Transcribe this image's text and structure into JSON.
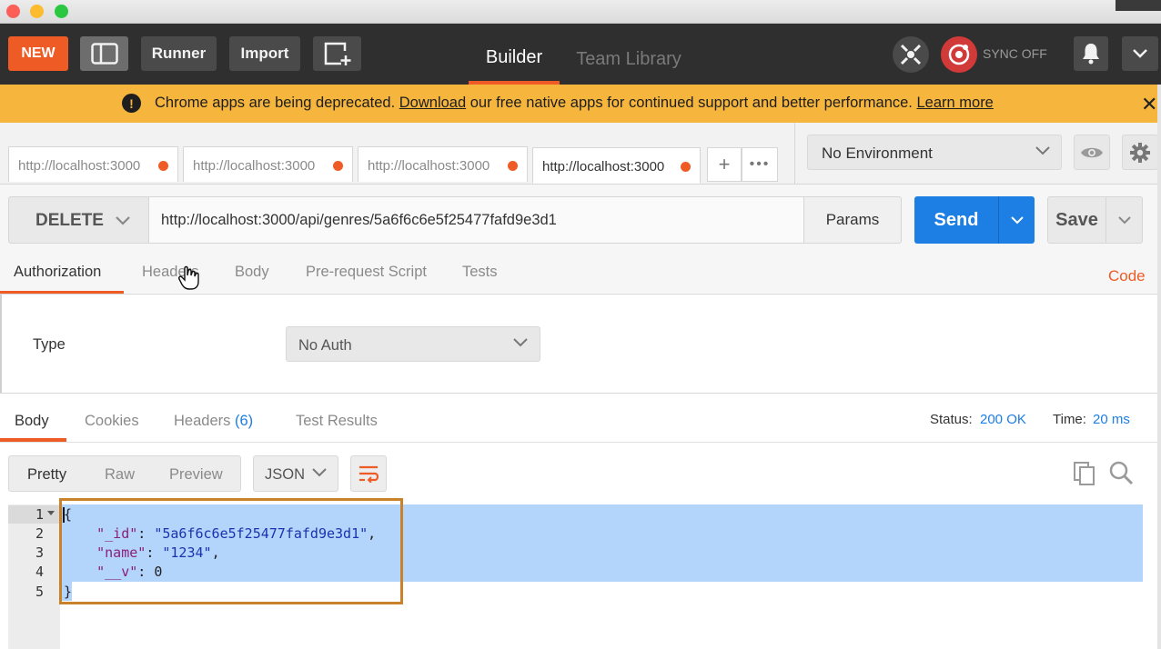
{
  "toolbar": {
    "new_label": "NEW",
    "runner_label": "Runner",
    "import_label": "Import",
    "tabs": [
      {
        "label": "Builder",
        "active": true
      },
      {
        "label": "Team Library",
        "active": false
      }
    ],
    "sync_label": "SYNC OFF",
    "accent_color": "#ef5b25"
  },
  "banner": {
    "text_before": "Chrome apps are being deprecated.",
    "download_link": "Download",
    "text_middle": "our free native apps for continued support and better performance.",
    "learn_more_link": "Learn more",
    "close_label": "✕",
    "color": "#f6b53d"
  },
  "request_tabs": [
    {
      "url": "http://localhost:3000",
      "unsaved": true,
      "active": false
    },
    {
      "url": "http://localhost:3000",
      "unsaved": true,
      "active": false
    },
    {
      "url": "http://localhost:3000",
      "unsaved": true,
      "active": false
    },
    {
      "url": "http://localhost:3000",
      "unsaved": true,
      "active": true
    }
  ],
  "tab_actions": {
    "add_label": "+",
    "more_label": "•••"
  },
  "environment": {
    "selected": "No Environment"
  },
  "request": {
    "method": "DELETE",
    "url": "http://localhost:3000/api/genres/5a6f6c6e5f25477fafd9e3d1",
    "params_label": "Params",
    "send_label": "Send",
    "save_label": "Save",
    "send_color": "#1d7ee3"
  },
  "request_subtabs": {
    "authorization": "Authorization",
    "headers": "Headers",
    "body": "Body",
    "pre_request": "Pre-request Script",
    "tests": "Tests",
    "code_link": "Code"
  },
  "auth": {
    "type_label": "Type",
    "selected": "No Auth"
  },
  "response": {
    "tabs": {
      "body": "Body",
      "cookies": "Cookies",
      "headers": "Headers",
      "headers_count": "(6)",
      "test_results": "Test Results"
    },
    "status_label": "Status:",
    "status_value": "200 OK",
    "time_label": "Time:",
    "time_value": "20 ms",
    "formats": {
      "pretty": "Pretty",
      "raw": "Raw",
      "preview": "Preview"
    },
    "language": "JSON",
    "line_numbers": [
      "1",
      "2",
      "3",
      "4",
      "5"
    ],
    "json": {
      "open": "{",
      "id_key": "\"_id\"",
      "id_value": "\"5a6f6c6e5f25477fafd9e3d1\"",
      "name_key": "\"name\"",
      "name_value": "\"1234\"",
      "v_key": "\"__v\"",
      "v_value": "0",
      "close": "}"
    }
  }
}
